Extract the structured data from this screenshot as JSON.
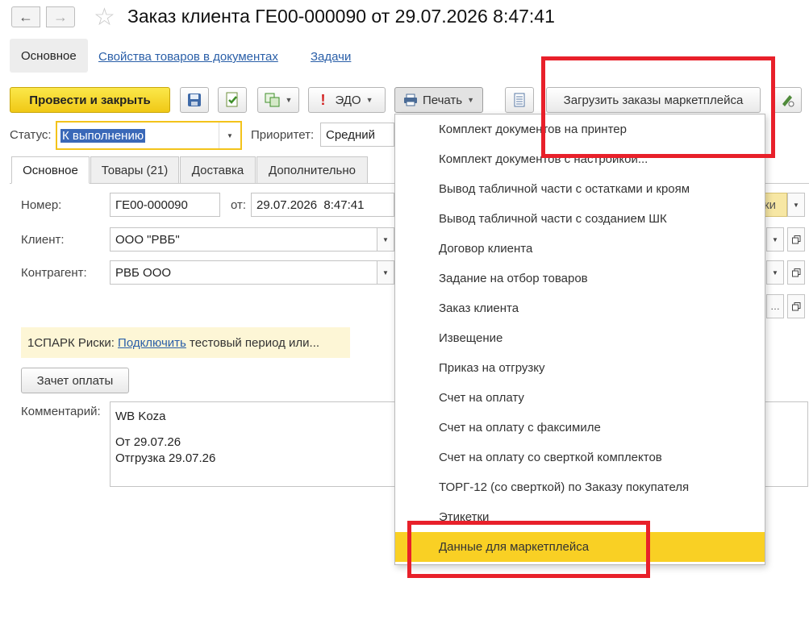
{
  "window": {
    "title": "Заказ клиента ГЕ00-000090 от 29.07.2026 8:47:41",
    "back_icon": "arrow-left-icon",
    "forward_icon": "arrow-right-icon",
    "favorite_icon": "star-outline-icon"
  },
  "sections": {
    "main": "Основное",
    "item_properties": "Свойства товаров в документах",
    "tasks": "Задачи"
  },
  "toolbar": {
    "post_close": "Провести и закрыть",
    "edo": "ЭДО",
    "print": "Печать",
    "load_marketplace": "Загрузить заказы маркетплейса"
  },
  "status": {
    "label": "Статус:",
    "value": "К выполнению",
    "priority_label": "Приоритет:",
    "priority_value": "Средний"
  },
  "tabs": [
    "Основное",
    "Товары (21)",
    "Доставка",
    "Дополнительно"
  ],
  "form": {
    "number_label": "Номер:",
    "number_value": "ГЕ00-000090",
    "date_label": "от:",
    "date_value": "29.07.2026  8:47:41",
    "client_label": "Клиент:",
    "client_value": "ООО \"РВБ\"",
    "contractor_label": "Контрагент:",
    "contractor_value": "РВБ ООО",
    "spark_prefix": "1СПАРК Риски: ",
    "spark_link": "Подключить",
    "spark_suffix": " тестовый период или...",
    "offset_button": "Зачет оплаты",
    "comment_label": "Комментарий:",
    "comment_lines": [
      "WB Koza",
      "",
      "От 29.07.26",
      "Отгрузка 29.07.26"
    ],
    "side_button_text": "ки"
  },
  "print_menu": {
    "items": [
      "Комплект документов на принтер",
      "Комплект документов с настройкой...",
      "Вывод табличной части с остатками и кроям",
      "Вывод табличной части с созданием ШК",
      "Договор клиента",
      "Задание на отбор товаров",
      "Заказ клиента",
      "Извещение",
      "Приказ на отгрузку",
      "Счет на оплату",
      "Счет на оплату с факсимиле",
      "Счет на оплату со сверткой комплектов",
      "ТОРГ-12 (со сверткой) по Заказу покупателя",
      "Этикетки",
      "Данные для маркетплейса"
    ],
    "highlighted_index": 14
  },
  "colors": {
    "primary_button": "#f5d420",
    "highlight": "#f9d024",
    "annotation": "#e8202a",
    "link": "#2a5fa8"
  }
}
